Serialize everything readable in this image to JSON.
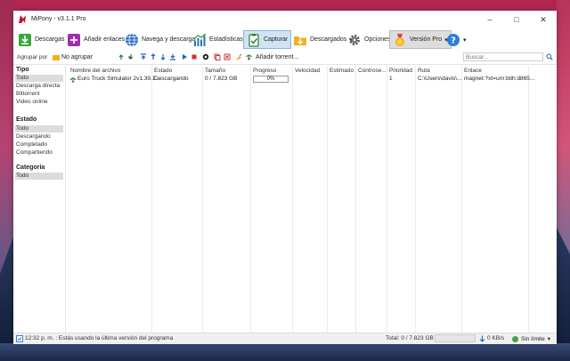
{
  "window": {
    "title": "MiPony - v3.1.1 Pro"
  },
  "toolbar": {
    "downloads": "Descargas",
    "add_links": "Añadir enlaces",
    "browse": "Navega y descarga",
    "stats": "Estadísticas",
    "capture": "Capturar",
    "downloaded": "Descargados",
    "options": "Opciones",
    "pro": "Versión Pro"
  },
  "secbar": {
    "group_label": "Agrupar por",
    "group_value": "No agrupar",
    "add_torrent": "Añadir torrent...",
    "search_placeholder": "Buscar..."
  },
  "sidebar": {
    "tipo": {
      "title": "Tipo",
      "items": [
        "Todo",
        "Descarga directa",
        "Bittorrent",
        "Video online"
      ]
    },
    "estado": {
      "title": "Estado",
      "items": [
        "Todo",
        "Descargando",
        "Completado",
        "Compartiendo"
      ]
    },
    "categoria": {
      "title": "Categoría",
      "items": [
        "Todo"
      ]
    }
  },
  "columns": [
    "Nombre del archivo",
    "Estado",
    "Tamaño",
    "Progreso",
    "Velocidad",
    "Estimado",
    "Controse...",
    "Prioridad",
    "Ruta",
    "Enlace"
  ],
  "rows": [
    {
      "name": "Euro Truck Simulator 2v1.39.1...",
      "status": "Descargando",
      "size": "0 / 7.823 GB",
      "progress_text": "0%",
      "progress": 0,
      "priority": "1",
      "path": "C:\\Users\\davis\\...",
      "link": "magnet:?xt=urn:btih:d865..."
    }
  ],
  "statusbar": {
    "time": "12:32 p. m. : Estás usando la última versión del programa",
    "total": "Total: 0 / 7.823 GB",
    "speed": "0 KB/s",
    "limit": "Sin límite"
  }
}
